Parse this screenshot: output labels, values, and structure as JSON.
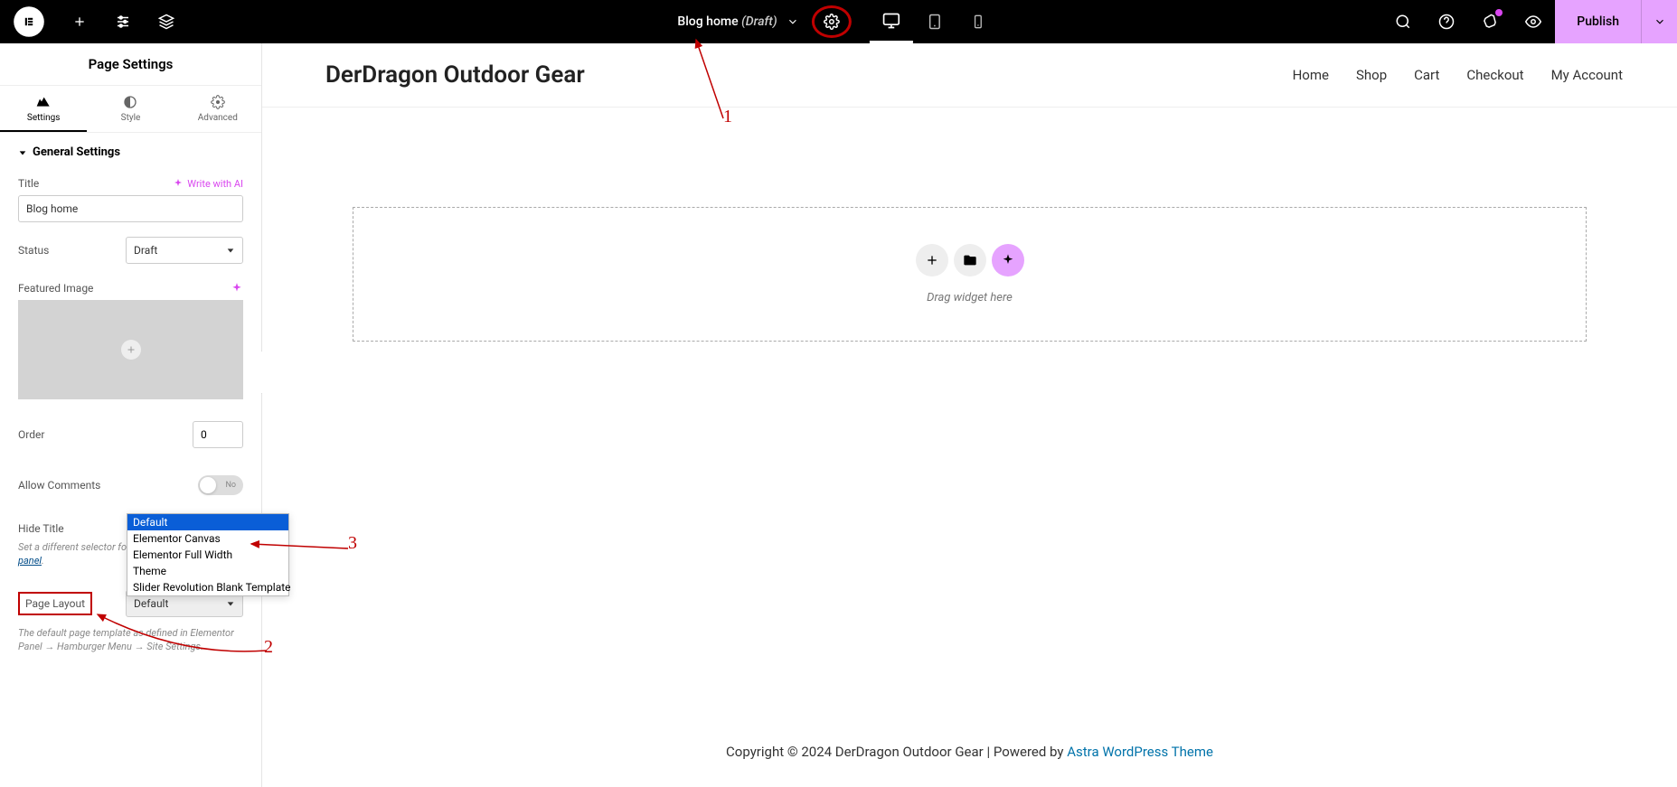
{
  "topbar": {
    "title": "Blog home",
    "status_label": "(Draft)",
    "publish_label": "Publish"
  },
  "sidebar": {
    "panel_title": "Page Settings",
    "tabs": {
      "settings": "Settings",
      "style": "Style",
      "advanced": "Advanced"
    },
    "section_general": "General Settings",
    "title_label": "Title",
    "write_ai": "Write with AI",
    "title_value": "Blog home",
    "status_label": "Status",
    "status_value": "Draft",
    "featured_label": "Featured Image",
    "order_label": "Order",
    "order_value": "0",
    "allow_comments_label": "Allow Comments",
    "allow_comments_toggle": "No",
    "hide_title_label": "Hide Title",
    "hide_title_help_prefix": "Set a different selector fo",
    "hide_title_help_link": "panel",
    "page_layout_label": "Page Layout",
    "page_layout_value": "Default",
    "page_layout_help": "The default page template as defined in Elementor Panel → Hamburger Menu → Site Settings.",
    "layout_options": [
      "Default",
      "Elementor Canvas",
      "Elementor Full Width",
      "Theme",
      "Slider Revolution Blank Template"
    ]
  },
  "preview": {
    "site_title": "DerDragon Outdoor Gear",
    "nav": [
      "Home",
      "Shop",
      "Cart",
      "Checkout",
      "My Account"
    ],
    "drag_hint": "Drag widget here",
    "footer_text": "Copyright © 2024 DerDragon Outdoor Gear | Powered by ",
    "footer_link": "Astra WordPress Theme"
  },
  "annotations": {
    "n1": "1",
    "n2": "2",
    "n3": "3"
  }
}
